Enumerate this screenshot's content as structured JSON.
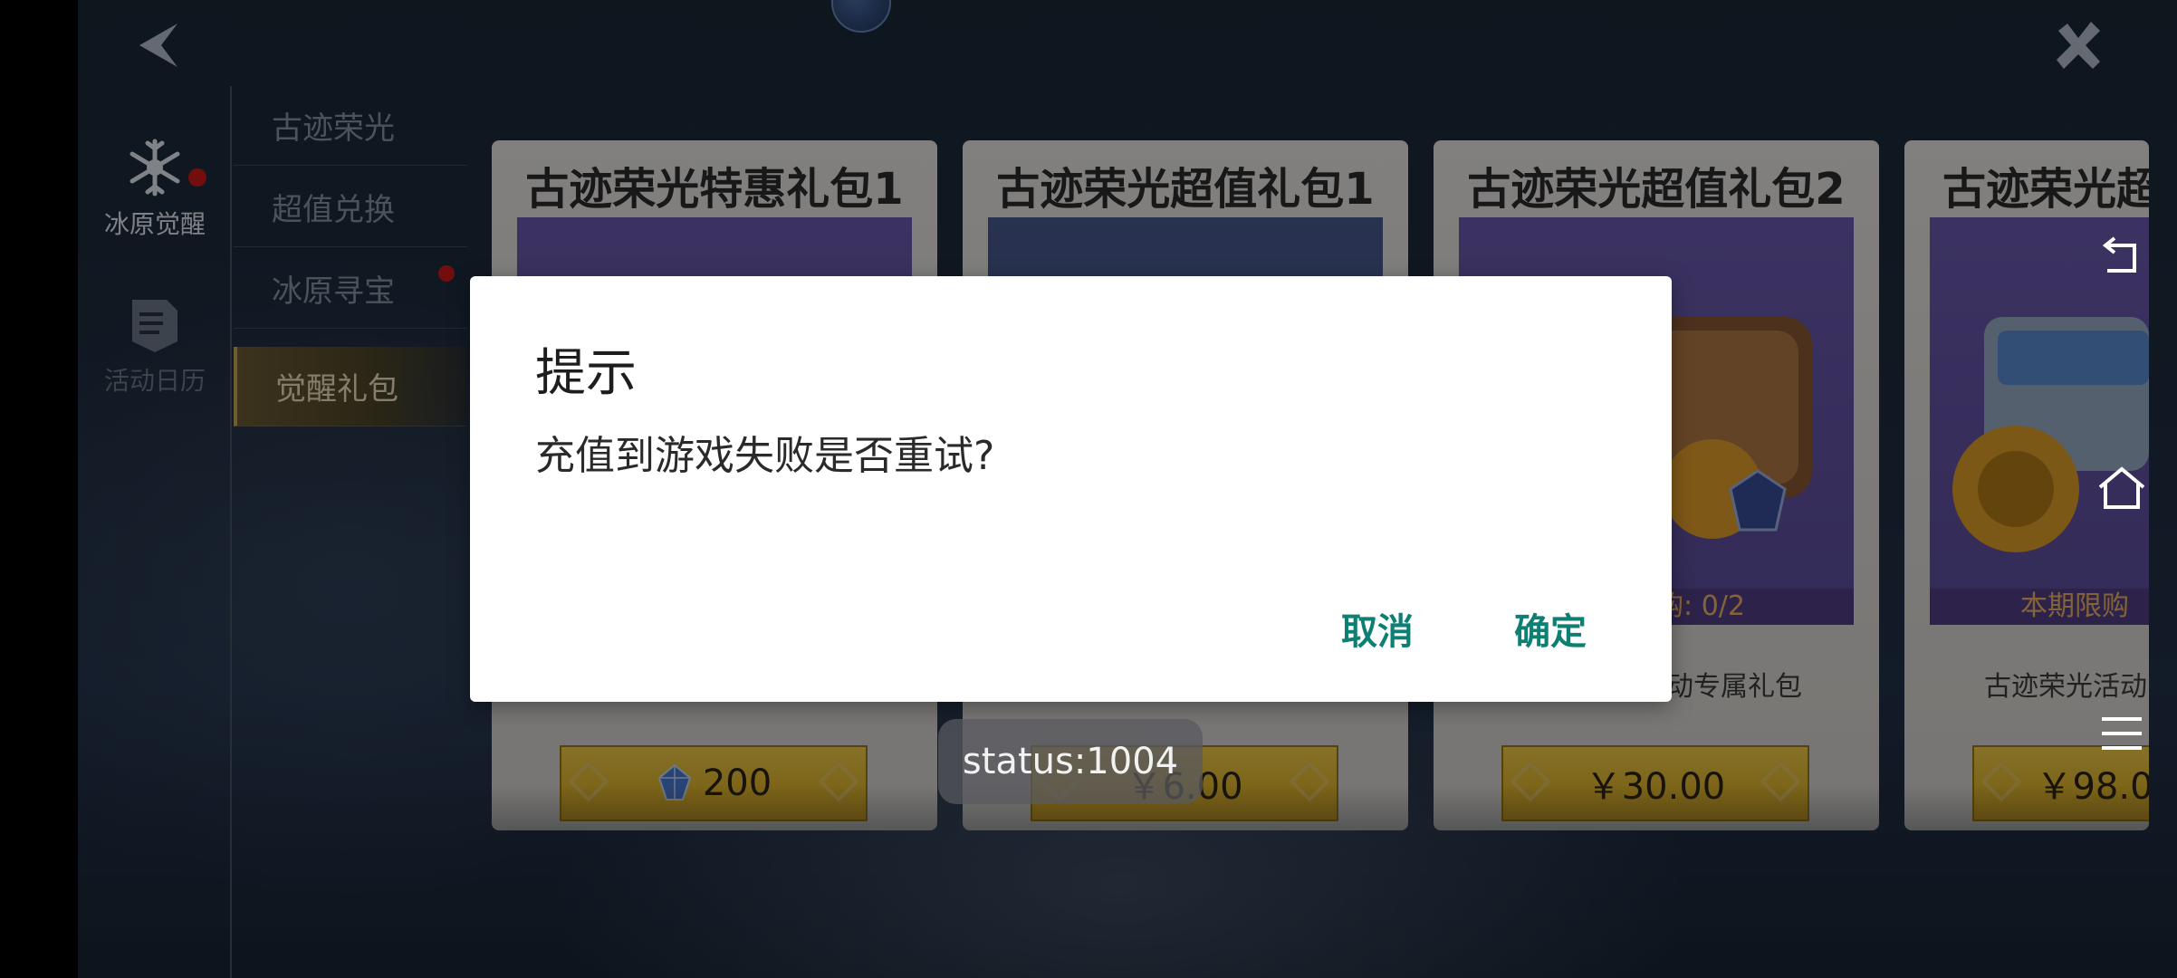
{
  "left_rail": [
    {
      "label": "冰原觉醒",
      "icon": "snowflake-icon",
      "active": true,
      "badge": true
    },
    {
      "label": "活动日历",
      "icon": "calendar-book-icon",
      "active": false,
      "badge": false
    }
  ],
  "menu": [
    {
      "label": "古迹荣光",
      "active": false
    },
    {
      "label": "超值兑换",
      "active": false
    },
    {
      "label": "冰原寻宝",
      "active": false
    },
    {
      "label": "觉醒礼包",
      "active": true
    }
  ],
  "cards": [
    {
      "title": "古迹荣光特惠礼包1",
      "price": "200",
      "price_icon": "crystal-gem-icon",
      "limit": "",
      "desc": ""
    },
    {
      "title": "古迹荣光超值礼包1",
      "price": "￥6.00",
      "price_icon": "",
      "limit": "",
      "desc": ""
    },
    {
      "title": "古迹荣光超值礼包2",
      "price": "￥30.00",
      "price_icon": "",
      "limit": "购: 0/2",
      "desc": "动专属礼包"
    },
    {
      "title": "古迹荣光超",
      "price": "￥98.0",
      "price_icon": "",
      "limit": "本期限购",
      "desc": "古迹荣光活动"
    }
  ],
  "dialog": {
    "title": "提示",
    "message": "充值到游戏失败是否重试?",
    "cancel": "取消",
    "confirm": "确定"
  },
  "toast": "status:1004",
  "colors": {
    "accent_teal": "#0d7f73",
    "menu_active": "#6e5d35",
    "price_gold": "#f3cf48",
    "card_purple": "#6d5cb2",
    "badge_red": "#d21b1b"
  }
}
